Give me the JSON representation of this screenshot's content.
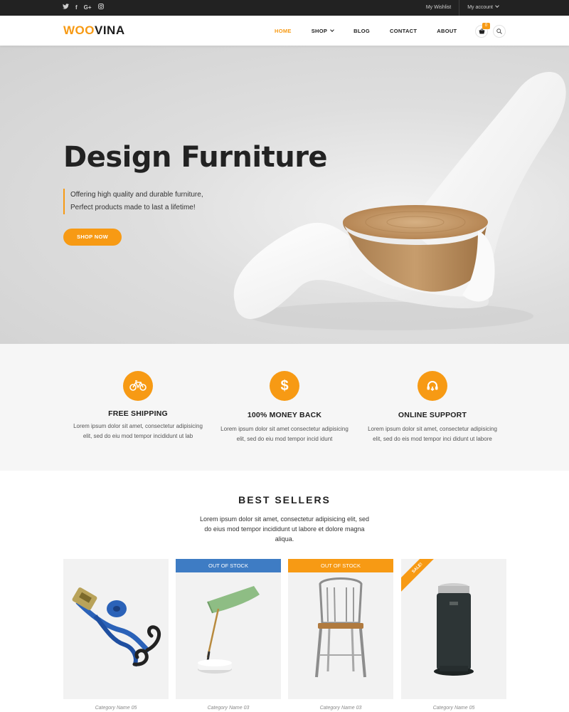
{
  "colors": {
    "accent": "#f79a14",
    "topbar": "#222222",
    "badge_blue": "#3e7cc4",
    "features_bg": "#f6f6f6"
  },
  "topbar": {
    "social": [
      {
        "name": "twitter-icon",
        "glyph": "🐦︎"
      },
      {
        "name": "facebook-icon",
        "glyph": "f"
      },
      {
        "name": "google-plus-icon",
        "glyph": "G+"
      },
      {
        "name": "instagram-icon",
        "glyph": "◎"
      }
    ],
    "wishlist": "My Wishlist",
    "account": "My account"
  },
  "header": {
    "logo_part1": "WOO",
    "logo_part2": "VINA",
    "nav": {
      "home": "HOME",
      "shop": "SHOP",
      "blog": "BLOG",
      "contact": "CONTACT",
      "about": "ABOUT"
    },
    "cart_count": "0"
  },
  "hero": {
    "title": "Design Furniture",
    "subtitle_line1": "Offering high quality and durable furniture,",
    "subtitle_line2": "Perfect products made to last a lifetime!",
    "button": "SHOP NOW"
  },
  "features": [
    {
      "icon": "bicycle-icon",
      "title": "FREE SHIPPING",
      "line1": "Lorem ipsum dolor sit amet, consectetur adipisicing",
      "line2": "elit, sed do eiu mod tempor incididunt ut lab"
    },
    {
      "icon": "dollar-icon",
      "title": "100% MONEY BACK",
      "line1": "Lorem ipsum dolor sit amet consectetur adipisicing",
      "line2": "elit, sed do eiu mod tempor incid idunt"
    },
    {
      "icon": "headset-icon",
      "title": "ONLINE SUPPORT",
      "line1": "Lorem ipsum dolor sit amet, consectetur adipisicing",
      "line2": "elit, sed do eis mod tempor inci didunt ut labore"
    }
  ],
  "best_sellers": {
    "title": "BEST SELLERS",
    "desc_line1": "Lorem ipsum dolor sit amet, consectetur adipisicing elit, sed",
    "desc_line2": "do eius mod tempor incididunt ut labore et dolore magna",
    "desc_line3": "aliqua.",
    "products": [
      {
        "image": "ratchet-strap-image",
        "badge": "",
        "category": "Category Name 05"
      },
      {
        "image": "desk-lamp-image",
        "badge": "OUT OF STOCK",
        "badge_color": "#3e7cc4",
        "category": "Category Name 03"
      },
      {
        "image": "metal-chair-image",
        "badge": "OUT OF STOCK",
        "badge_color": "#f79a14",
        "category": "Category Name 03"
      },
      {
        "image": "pedal-bin-image",
        "badge": "SALE!",
        "category": "Category Name 05"
      }
    ]
  }
}
